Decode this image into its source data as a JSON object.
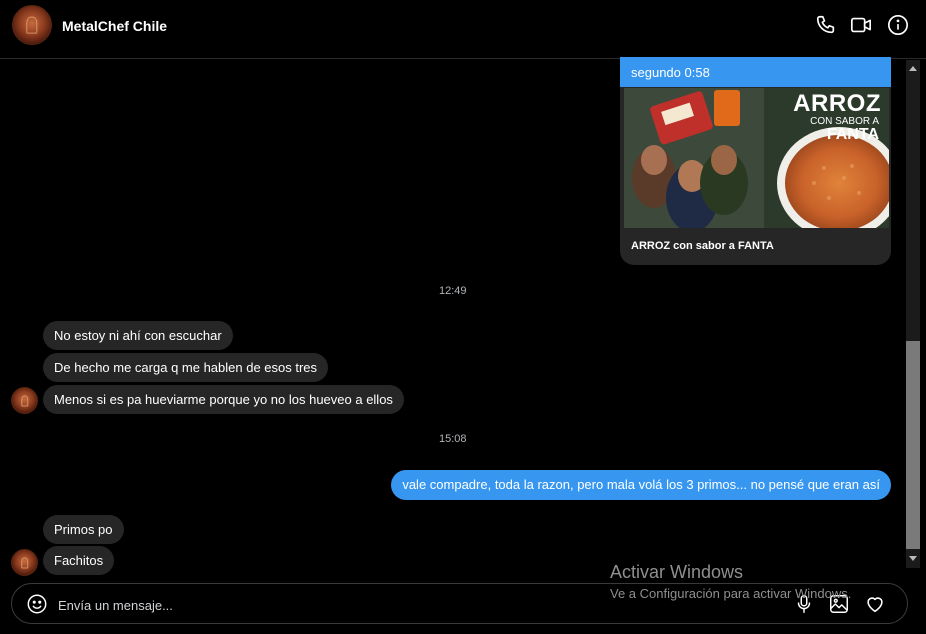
{
  "header": {
    "contact_name": "MetalChef Chile",
    "icons": [
      "phone-icon",
      "video-icon",
      "info-icon"
    ]
  },
  "shared_post": {
    "top_text": "segundo 0:58",
    "image_headline": "ARROZ",
    "image_sub_1": "CON SABOR A",
    "image_sub_2": "FANTA",
    "caption": "ARROZ con sabor a FANTA"
  },
  "messages": {
    "time_1": "12:49",
    "received_1": "No estoy ni ahí con escuchar",
    "received_2": "De hecho me carga q me hablen de esos tres",
    "received_3": "Menos si es pa hueviarme porque yo no los hueveo a ellos",
    "time_2": "15:08",
    "sent_1": "vale compadre, toda la razon, pero mala volá los 3 primos... no pensé que eran así",
    "received_4": "Primos po",
    "received_5": "Fachitos"
  },
  "composer": {
    "placeholder": "Envía un mensaje...",
    "icons": [
      "emoji-icon",
      "microphone-icon",
      "image-icon",
      "heart-icon"
    ]
  },
  "watermark": {
    "title": "Activar Windows",
    "subtitle": "Ve a Configuración para activar Windows."
  },
  "colors": {
    "sent_bubble": "#3797f0",
    "received_bubble": "#262626",
    "background": "#000000"
  }
}
